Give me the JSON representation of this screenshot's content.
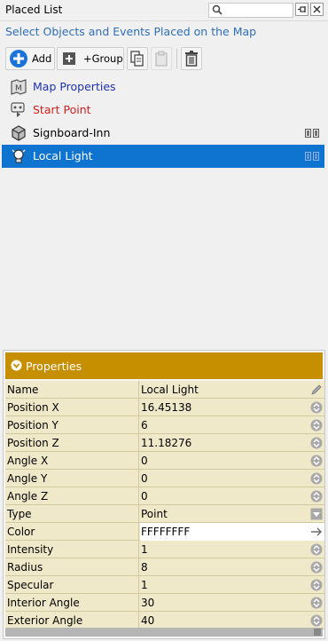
{
  "window": {
    "title": "Placed List",
    "search_value": ""
  },
  "subtitle": "Select Objects and Events Placed on the Map",
  "toolbar": {
    "add_label": "Add",
    "group_label": "+Group",
    "copy_icon": "copy-icon",
    "paste_icon": "paste-icon",
    "delete_icon": "trash-icon"
  },
  "tree": [
    {
      "label": "Map Properties",
      "color": "#1f33b0",
      "icon": "map-icon"
    },
    {
      "label": "Start Point",
      "color": "#d01f1f",
      "icon": "start-point-icon"
    },
    {
      "label": "Signboard-Inn",
      "color": "#000000",
      "icon": "box-icon"
    },
    {
      "label": "Local Light",
      "color": "#ffffff",
      "icon": "light-icon",
      "selected": true
    }
  ],
  "properties": {
    "header": "Properties",
    "rows": [
      {
        "key": "Name",
        "value": "Local Light",
        "action": "edit-icon"
      },
      {
        "key": "Position X",
        "value": "16.45138",
        "action": "stepper-icon"
      },
      {
        "key": "Position Y",
        "value": "6",
        "action": "stepper-icon"
      },
      {
        "key": "Position Z",
        "value": "11.18276",
        "action": "stepper-icon"
      },
      {
        "key": "Angle X",
        "value": "0",
        "action": "stepper-icon"
      },
      {
        "key": "Angle Y",
        "value": "0",
        "action": "stepper-icon"
      },
      {
        "key": "Angle Z",
        "value": "0",
        "action": "stepper-icon"
      },
      {
        "key": "Type",
        "value": "Point",
        "action": "dropdown-icon"
      },
      {
        "key": "Color",
        "value": "FFFFFFFF",
        "action": "arrow-right-icon"
      },
      {
        "key": "Intensity",
        "value": "1",
        "action": "stepper-icon"
      },
      {
        "key": "Radius",
        "value": "8",
        "action": "stepper-icon"
      },
      {
        "key": "Specular",
        "value": "1",
        "action": "stepper-icon"
      },
      {
        "key": "Interior Angle",
        "value": "30",
        "action": "stepper-icon"
      },
      {
        "key": "Exterior Angle",
        "value": "40",
        "action": "stepper-icon"
      }
    ]
  },
  "colors": {
    "accent": "#0f73d0",
    "header": "#c68f00",
    "subtitle": "#2f6fb5"
  }
}
